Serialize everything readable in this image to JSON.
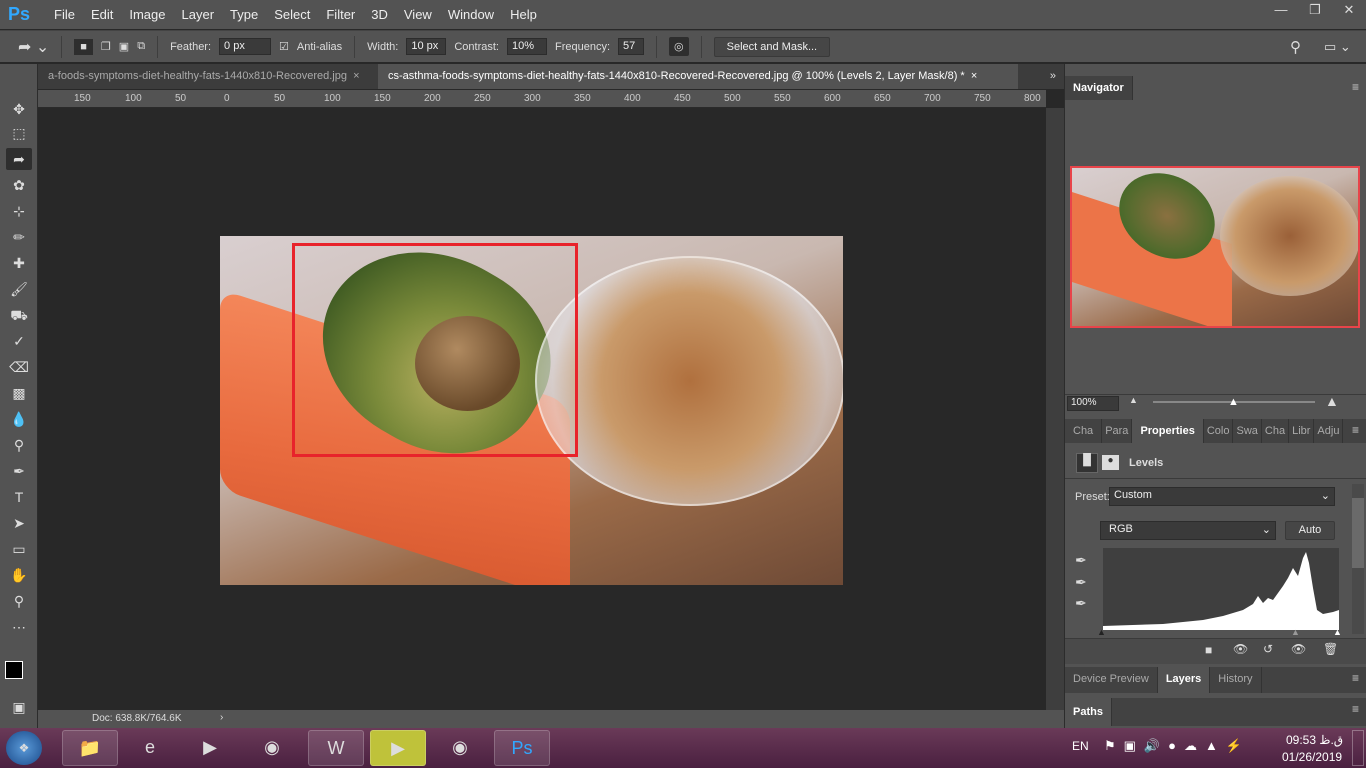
{
  "app": {
    "logo": "Ps",
    "menu": [
      "File",
      "Edit",
      "Image",
      "Layer",
      "Type",
      "Select",
      "Filter",
      "3D",
      "View",
      "Window",
      "Help"
    ],
    "window_controls": [
      "minimize",
      "restore",
      "close"
    ]
  },
  "options": {
    "feather_label": "Feather:",
    "feather_value": "0 px",
    "antialias_label": "Anti-alias",
    "antialias_checked": true,
    "width_label": "Width:",
    "width_value": "10 px",
    "contrast_label": "Contrast:",
    "contrast_value": "10%",
    "frequency_label": "Frequency:",
    "frequency_value": "57",
    "select_mask": "Select and Mask..."
  },
  "tabs": [
    {
      "label": "a-foods-symptoms-diet-healthy-fats-1440x810-Recovered.jpg",
      "active": false
    },
    {
      "label": "cs-asthma-foods-symptoms-diet-healthy-fats-1440x810-Recovered-Recovered.jpg @ 100% (Levels 2, Layer Mask/8) *",
      "active": true
    }
  ],
  "ruler": [
    "150",
    "100",
    "50",
    "0",
    "50",
    "100",
    "150",
    "200",
    "250",
    "300",
    "350",
    "400",
    "450",
    "500",
    "550",
    "600",
    "650",
    "700",
    "750",
    "800"
  ],
  "status": {
    "doc": "Doc: 638.8K/764.6K"
  },
  "navigator": {
    "title": "Navigator",
    "zoom": "100%"
  },
  "properties": {
    "tabs": [
      "Cha",
      "Para",
      "Properties",
      "Colo",
      "Swa",
      "Cha",
      "Libr",
      "Adju"
    ],
    "active": "Properties",
    "title": "Levels",
    "preset_label": "Preset:",
    "preset_value": "Custom",
    "channel": "RGB",
    "auto": "Auto"
  },
  "bottom_panels": {
    "tabs": [
      "Device Preview",
      "Layers",
      "History"
    ],
    "active": "Layers",
    "paths": "Paths"
  },
  "taskbar": {
    "lang": "EN",
    "time": "09:53 ق.ظ",
    "date": "01/26/2019"
  },
  "colors": {
    "selection": "#e8232b",
    "accent": "#31a8ff"
  }
}
